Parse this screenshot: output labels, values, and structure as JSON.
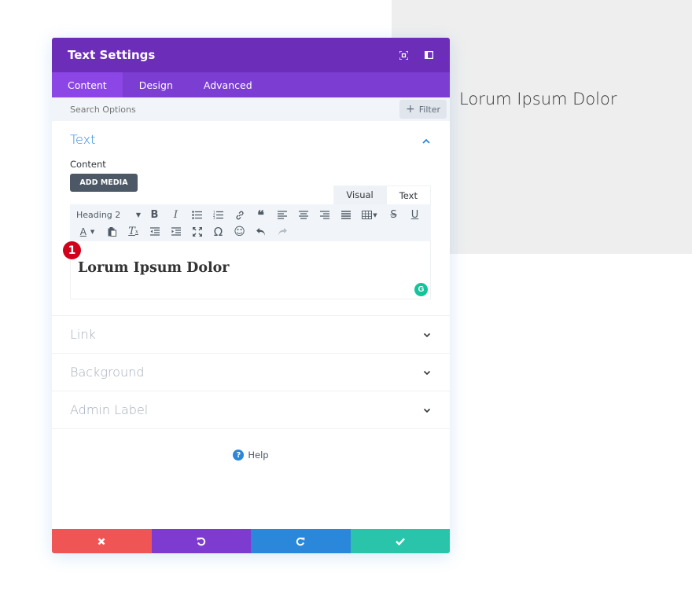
{
  "preview": {
    "text": "Lorum Ipsum Dolor",
    "background": "#eeeeee"
  },
  "panel": {
    "title": "Text Settings",
    "header_icons": [
      "expand-icon",
      "sidebar-layout-icon"
    ],
    "tabs": [
      {
        "label": "Content",
        "active": true
      },
      {
        "label": "Design",
        "active": false
      },
      {
        "label": "Advanced",
        "active": false
      }
    ],
    "search": {
      "placeholder": "Search Options",
      "filter_label": "Filter"
    },
    "text_section": {
      "title": "Text",
      "content_label": "Content",
      "add_media_label": "ADD MEDIA",
      "mode_tabs": [
        "Visual",
        "Text"
      ],
      "toolbar": {
        "format_select": "Heading 2",
        "row1": [
          "bold",
          "italic",
          "bullet-list",
          "numbered-list",
          "link",
          "blockquote",
          "align-left",
          "align-center",
          "align-right",
          "align-justify",
          "table",
          "strikethrough",
          "underline"
        ],
        "row2": [
          "text-color",
          "paste-as-text",
          "clear-formatting",
          "outdent",
          "indent",
          "fullscreen",
          "special-character",
          "emoji",
          "undo",
          "redo"
        ]
      },
      "editor_content": "Lorum Ipsum Dolor",
      "badge_number": "1"
    },
    "collapsed_sections": [
      {
        "title": "Link"
      },
      {
        "title": "Background"
      },
      {
        "title": "Admin Label"
      }
    ],
    "help_label": "Help",
    "footer_buttons": [
      {
        "name": "cancel",
        "color": "#ef5555"
      },
      {
        "name": "undo",
        "color": "#7e3bd0"
      },
      {
        "name": "redo",
        "color": "#2b87da"
      },
      {
        "name": "save",
        "color": "#29c4a9"
      }
    ]
  }
}
